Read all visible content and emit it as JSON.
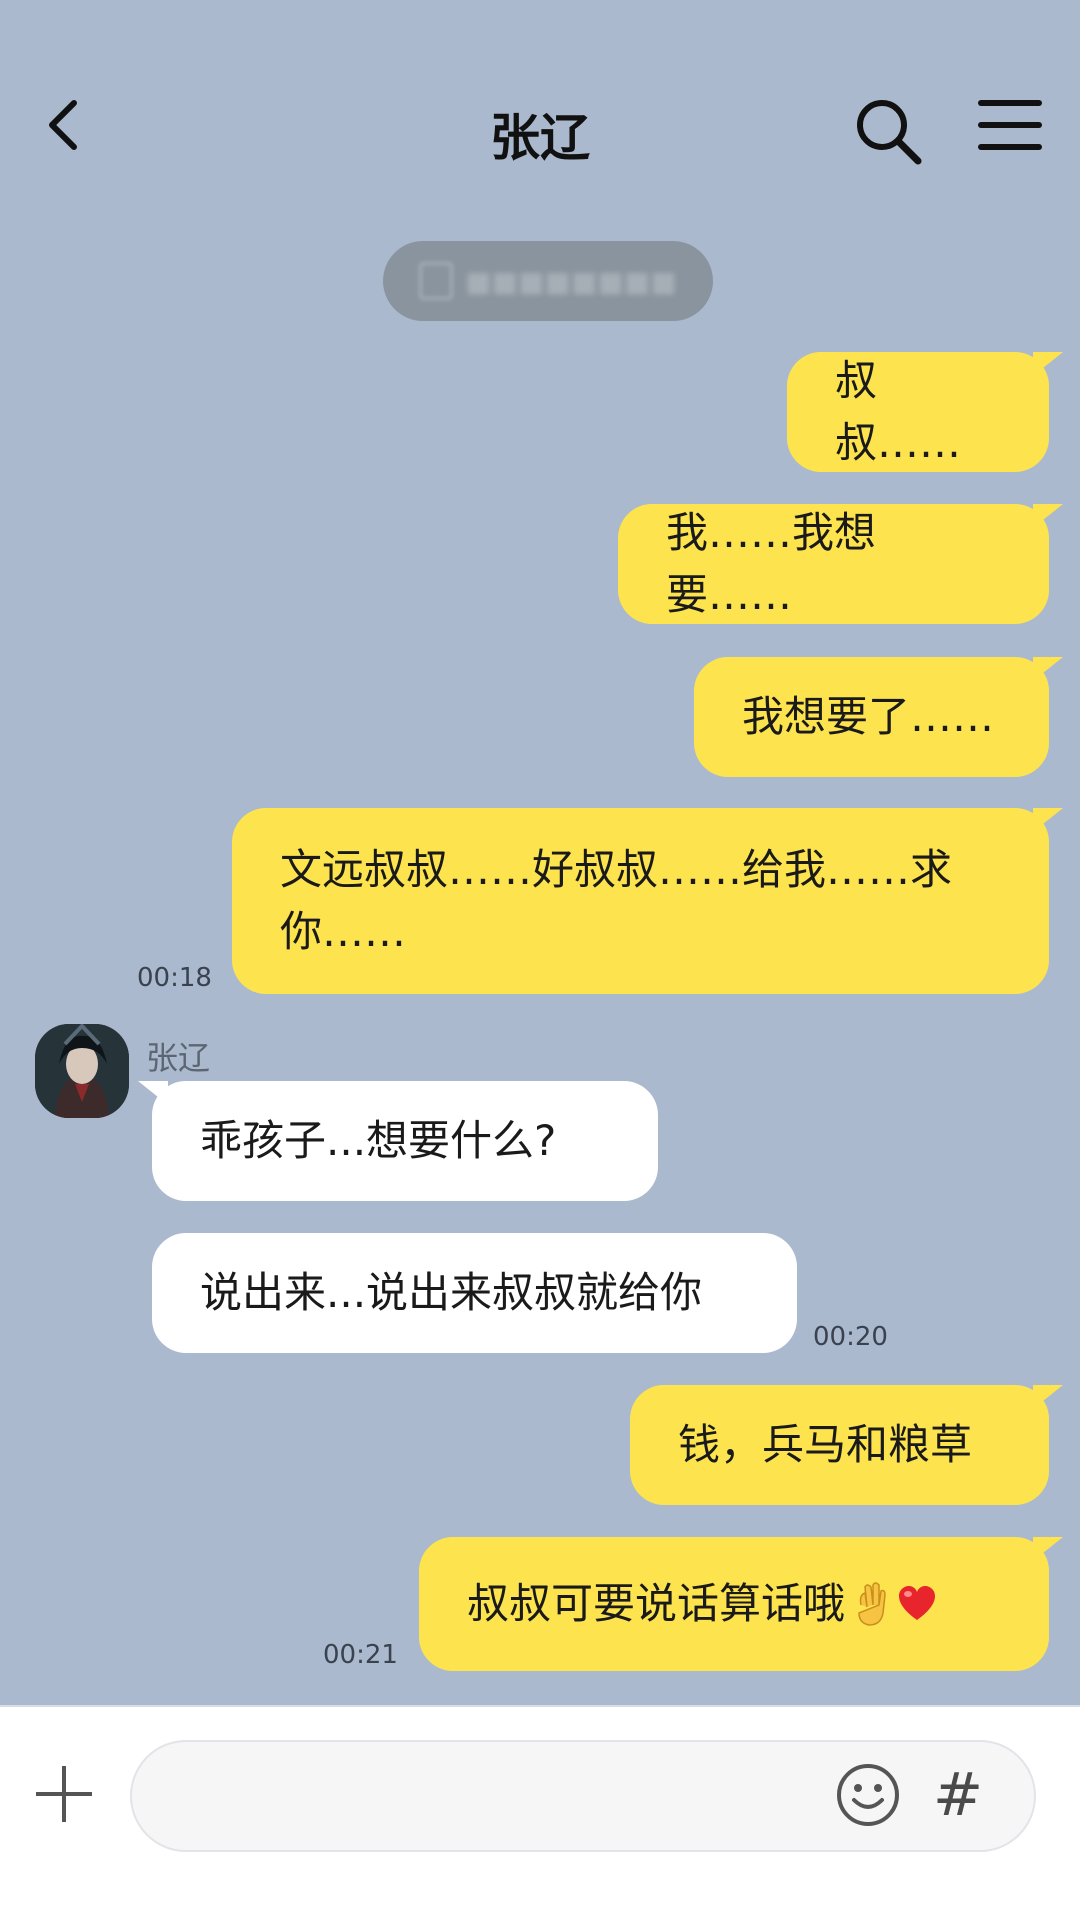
{
  "header": {
    "title": "张辽"
  },
  "messages": {
    "m1": "叔叔……",
    "m2": "我……我想要……",
    "m3": "我想要了……",
    "m4_line1": "文远叔叔……好叔叔……给我……求",
    "m4_line2": "你……",
    "m4_time": "00:18",
    "sender_name": "张辽",
    "m5": "乖孩子...想要什么?",
    "m6": "说出来...说出来叔叔就给你",
    "m6_time": "00:20",
    "m7": "钱，兵马和粮草",
    "m8": "叔叔可要说话算话哦",
    "m8_time": "00:21"
  },
  "input": {
    "placeholder": ""
  },
  "colors": {
    "background": "#aab9cd",
    "outgoing": "#fde44f",
    "incoming": "#ffffff"
  },
  "icons": [
    "back-icon",
    "search-icon",
    "menu-icon",
    "calendar-icon",
    "plus-icon",
    "smile-icon",
    "hash-icon",
    "hand-icon",
    "heart-icon"
  ]
}
